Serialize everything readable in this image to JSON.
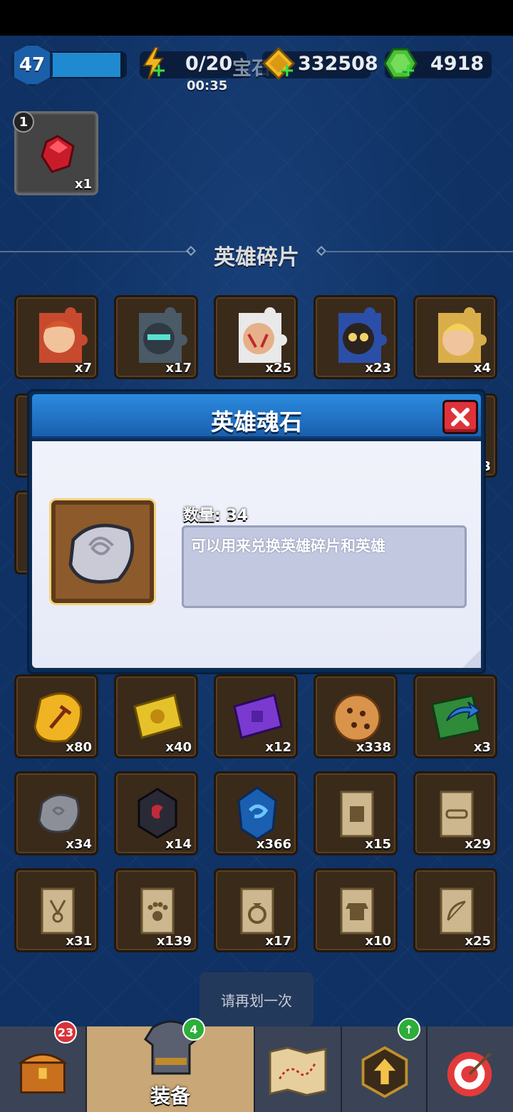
{
  "hud": {
    "level": "47",
    "xp_fraction": 0.95,
    "energy": "0/20",
    "energy_timer": "00:35",
    "hidden_label": "宝石",
    "gold": "332508",
    "gems": "4918"
  },
  "top_item": {
    "badge": "1",
    "qty": "x1",
    "icon": "red-gem-icon"
  },
  "section_hero_shards": {
    "title": "英雄碎片"
  },
  "hero_shards": [
    {
      "qty": "x7",
      "icon": "hero-shard-red-icon"
    },
    {
      "qty": "x17",
      "icon": "hero-shard-knight-icon"
    },
    {
      "qty": "x25",
      "icon": "hero-shard-warrior-icon"
    },
    {
      "qty": "x23",
      "icon": "hero-shard-panda-icon"
    },
    {
      "qty": "x4",
      "icon": "hero-shard-elf-icon"
    }
  ],
  "hidden_row_partial": {
    "qty": "3"
  },
  "materials": [
    {
      "qty": "x80",
      "icon": "gold-hammer-stone-icon"
    },
    {
      "qty": "x40",
      "icon": "gold-ticket-icon"
    },
    {
      "qty": "x12",
      "icon": "purple-ticket-icon"
    },
    {
      "qty": "x338",
      "icon": "cookie-icon"
    },
    {
      "qty": "x3",
      "icon": "reset-card-icon"
    },
    {
      "qty": "x34",
      "icon": "hero-soulstone-icon"
    },
    {
      "qty": "x14",
      "icon": "dark-soulstone-icon"
    },
    {
      "qty": "x366",
      "icon": "blue-crystal-icon"
    },
    {
      "qty": "x15",
      "icon": "scroll-book-icon"
    },
    {
      "qty": "x29",
      "icon": "scroll-belt-icon"
    },
    {
      "qty": "x31",
      "icon": "scroll-necklace-icon"
    },
    {
      "qty": "x139",
      "icon": "scroll-paw-icon"
    },
    {
      "qty": "x17",
      "icon": "scroll-ring-icon"
    },
    {
      "qty": "x10",
      "icon": "scroll-armor-icon"
    },
    {
      "qty": "x25",
      "icon": "scroll-bow-icon"
    }
  ],
  "modal": {
    "title": "英雄魂石",
    "quantity_label": "数量: 34",
    "description": "可以用来兑换英雄碎片和英雄"
  },
  "toast": {
    "text": "请再划一次"
  },
  "bottom_nav": {
    "chest_badge": "23",
    "equip_badge": "4",
    "equip_label": "装备"
  }
}
